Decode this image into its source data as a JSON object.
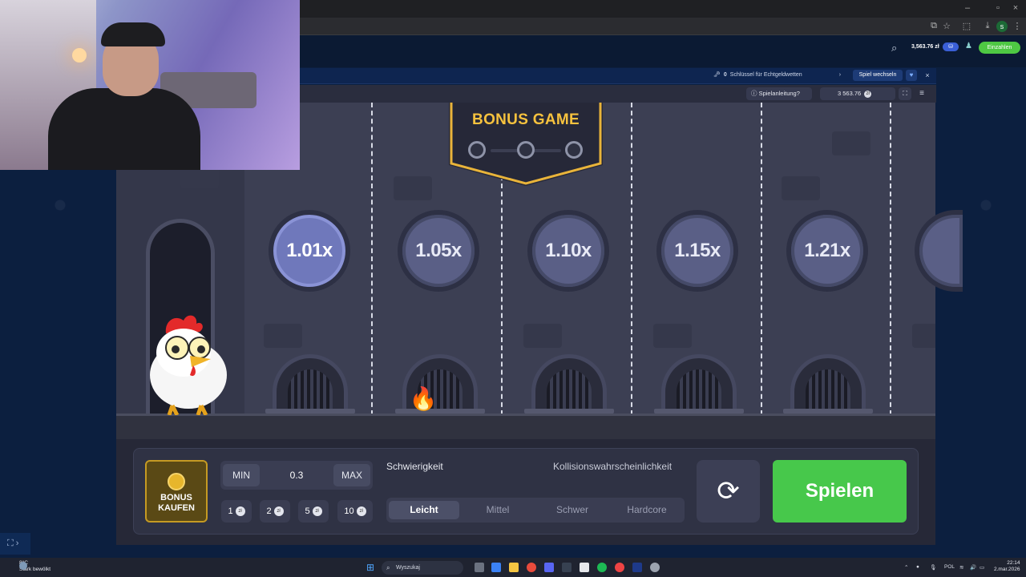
{
  "header": {
    "balance": "3,563.76 zł",
    "currency_badge": "⛁",
    "deposit_label": "Einzahlen"
  },
  "game_bar": {
    "key_count": "0",
    "key_text": "Schlüssel für Echtgeldwetten",
    "switch_label": "Spiel wechseln"
  },
  "game": {
    "help_label": "Spielanleitung?",
    "balance": "3 563.76",
    "currency_symbol": "zł",
    "bonus_title": "BONUS GAME",
    "multipliers": [
      "1.01x",
      "1.05x",
      "1.10x",
      "1.15x",
      "1.21x"
    ],
    "controls": {
      "bonus_buy_label": "BONUS\nKAUFEN",
      "min_label": "MIN",
      "bet_value": "0.3",
      "max_label": "MAX",
      "chips": [
        "1",
        "2",
        "5",
        "10"
      ],
      "chip_currency": "zł",
      "difficulty_label": "Schwierigkeit",
      "collision_label": "Kollisionswahrscheinlichkeit",
      "difficulties": [
        "Leicht",
        "Mittel",
        "Schwer",
        "Hardcore"
      ],
      "selected_difficulty": "Leicht",
      "play_label": "Spielen"
    }
  },
  "taskbar": {
    "weather_temp": "8°C",
    "weather_desc": "Stark bewölkt",
    "search_placeholder": "Wyszukaj",
    "lang": "POL",
    "time": "22:14",
    "date": "2.mar.2026"
  },
  "colors": {
    "play_green": "#47c84b",
    "bonus_gold": "#f6c23e",
    "multiplier_active": "#6f78bb"
  }
}
